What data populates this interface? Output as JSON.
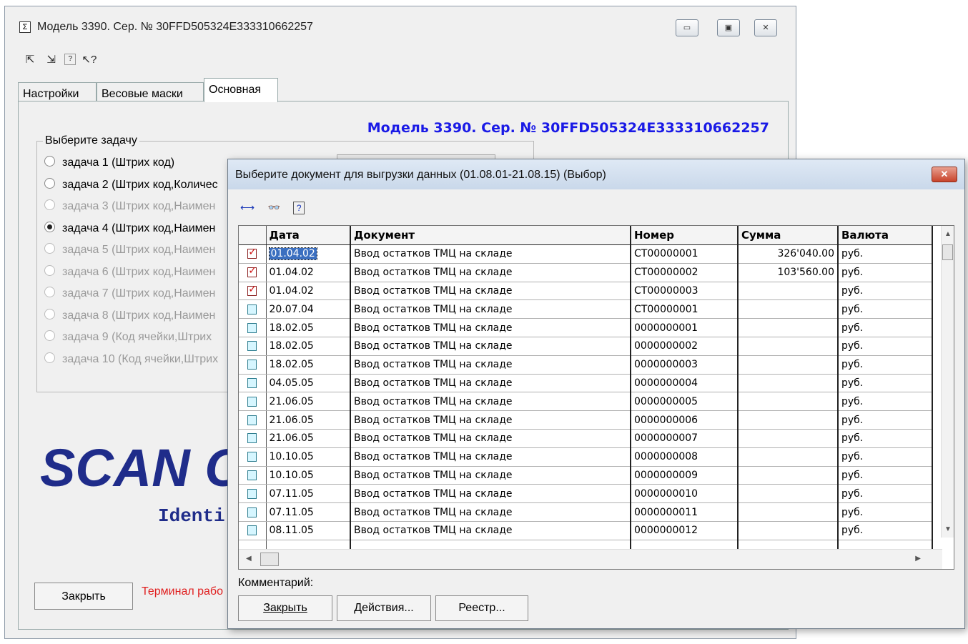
{
  "main_window": {
    "title": "Модель 3390. Сер. № 30FFD505324E333310662257",
    "title_icon": "Σ",
    "window_buttons": {
      "minimize": "▭",
      "maximize": "▣",
      "close": "✕"
    },
    "toolbar_icons": [
      "load-from-terminal-icon",
      "load-to-terminal-icon",
      "help-icon",
      "context-help-icon"
    ],
    "tabs": [
      {
        "label": "Настройки",
        "active": false
      },
      {
        "label": "Весовые маски",
        "active": false
      },
      {
        "label": "Основная",
        "active": true
      }
    ],
    "heading": "Модель 3390. Сер. № 30FFD505324E333310662257",
    "group_label": "Выберите задачу",
    "tasks": [
      {
        "label": "задача 1 (Штрих код)",
        "checked": false,
        "enabled": true
      },
      {
        "label": "задача 2 (Штрих код,Количес",
        "checked": false,
        "enabled": true
      },
      {
        "label": "задача 3 (Штрих код,Наимен",
        "checked": false,
        "enabled": false
      },
      {
        "label": "задача 4 (Штрих код,Наимен",
        "checked": true,
        "enabled": true
      },
      {
        "label": "задача 5 (Штрих код,Наимен",
        "checked": false,
        "enabled": false
      },
      {
        "label": "задача 6 (Штрих код,Наимен",
        "checked": false,
        "enabled": false
      },
      {
        "label": "задача 7 (Штрих код,Наимен",
        "checked": false,
        "enabled": false
      },
      {
        "label": "задача 8 (Штрих код,Наимен",
        "checked": false,
        "enabled": false
      },
      {
        "label": "задача 9 (Код ячейки,Штрих",
        "checked": false,
        "enabled": false
      },
      {
        "label": "задача 10 (Код ячейки,Штрих",
        "checked": false,
        "enabled": false
      }
    ],
    "logo_text": "SCAN C",
    "logo_subtext": "Identi",
    "close_label": "Закрыть",
    "terminal_status": "Терминал рабо",
    "colors": {
      "heading": "#1a1ae6",
      "logo": "#1f2c8a",
      "status": "#e02020"
    }
  },
  "dialog": {
    "title": "Выберите документ для выгрузки данных (01.08.01-21.08.15) (Выбор)",
    "toolbar_icons": [
      "fit-columns-icon",
      "binoculars-search-icon",
      "help-icon"
    ],
    "columns": [
      "Дата",
      "Документ",
      "Номер",
      "Сумма",
      "Валюта"
    ],
    "rows": [
      {
        "checked": true,
        "date": "01.04.02",
        "doc": "Ввод остатков ТМЦ на складе",
        "num": "СТ00000001",
        "sum": "326'040.00",
        "cur": "руб."
      },
      {
        "checked": true,
        "date": "01.04.02",
        "doc": "Ввод остатков ТМЦ на складе",
        "num": "СТ00000002",
        "sum": "103'560.00",
        "cur": "руб."
      },
      {
        "checked": true,
        "date": "01.04.02",
        "doc": "Ввод остатков ТМЦ на складе",
        "num": "СТ00000003",
        "sum": "",
        "cur": "руб."
      },
      {
        "checked": false,
        "date": "20.07.04",
        "doc": "Ввод остатков ТМЦ на складе",
        "num": "СТ00000001",
        "sum": "",
        "cur": "руб."
      },
      {
        "checked": false,
        "date": "18.02.05",
        "doc": "Ввод остатков ТМЦ на складе",
        "num": "0000000001",
        "sum": "",
        "cur": "руб."
      },
      {
        "checked": false,
        "date": "18.02.05",
        "doc": "Ввод остатков ТМЦ на складе",
        "num": "0000000002",
        "sum": "",
        "cur": "руб."
      },
      {
        "checked": false,
        "date": "18.02.05",
        "doc": "Ввод остатков ТМЦ на складе",
        "num": "0000000003",
        "sum": "",
        "cur": "руб."
      },
      {
        "checked": false,
        "date": "04.05.05",
        "doc": "Ввод остатков ТМЦ на складе",
        "num": "0000000004",
        "sum": "",
        "cur": "руб."
      },
      {
        "checked": false,
        "date": "21.06.05",
        "doc": "Ввод остатков ТМЦ на складе",
        "num": "0000000005",
        "sum": "",
        "cur": "руб."
      },
      {
        "checked": false,
        "date": "21.06.05",
        "doc": "Ввод остатков ТМЦ на складе",
        "num": "0000000006",
        "sum": "",
        "cur": "руб."
      },
      {
        "checked": false,
        "date": "21.06.05",
        "doc": "Ввод остатков ТМЦ на складе",
        "num": "0000000007",
        "sum": "",
        "cur": "руб."
      },
      {
        "checked": false,
        "date": "10.10.05",
        "doc": "Ввод остатков ТМЦ на складе",
        "num": "0000000008",
        "sum": "",
        "cur": "руб."
      },
      {
        "checked": false,
        "date": "10.10.05",
        "doc": "Ввод остатков ТМЦ на складе",
        "num": "0000000009",
        "sum": "",
        "cur": "руб."
      },
      {
        "checked": false,
        "date": "07.11.05",
        "doc": "Ввод остатков ТМЦ на складе",
        "num": "0000000010",
        "sum": "",
        "cur": "руб."
      },
      {
        "checked": false,
        "date": "07.11.05",
        "doc": "Ввод остатков ТМЦ на складе",
        "num": "0000000011",
        "sum": "",
        "cur": "руб."
      },
      {
        "checked": false,
        "date": "08.11.05",
        "doc": "Ввод остатков ТМЦ на складе",
        "num": "0000000012",
        "sum": "",
        "cur": "руб."
      }
    ],
    "comment_label": "Комментарий:",
    "buttons": {
      "close": "Закрыть",
      "actions": "Действия...",
      "registry": "Реестр..."
    }
  }
}
